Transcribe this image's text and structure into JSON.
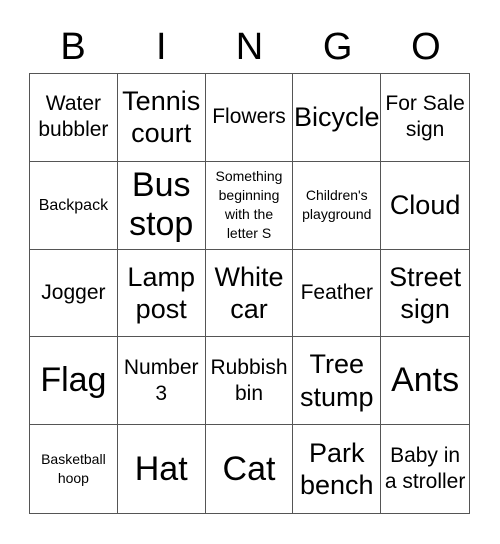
{
  "header": [
    "B",
    "I",
    "N",
    "G",
    "O"
  ],
  "cells": [
    {
      "text": "Water bubbler",
      "size": "m"
    },
    {
      "text": "Tennis court",
      "size": "l"
    },
    {
      "text": "Flowers",
      "size": "m"
    },
    {
      "text": "Bicycle",
      "size": "l"
    },
    {
      "text": "For Sale sign",
      "size": "m"
    },
    {
      "text": "Backpack",
      "size": "s"
    },
    {
      "text": "Bus stop",
      "size": "xl"
    },
    {
      "text": "Something beginning with the letter S",
      "size": "xs"
    },
    {
      "text": "Children's playground",
      "size": "xs"
    },
    {
      "text": "Cloud",
      "size": "l"
    },
    {
      "text": "Jogger",
      "size": "m"
    },
    {
      "text": "Lamp post",
      "size": "l"
    },
    {
      "text": "White car",
      "size": "l"
    },
    {
      "text": "Feather",
      "size": "m"
    },
    {
      "text": "Street sign",
      "size": "l"
    },
    {
      "text": "Flag",
      "size": "xl"
    },
    {
      "text": "Number 3",
      "size": "m"
    },
    {
      "text": "Rubbish bin",
      "size": "m"
    },
    {
      "text": "Tree stump",
      "size": "l"
    },
    {
      "text": "Ants",
      "size": "xl"
    },
    {
      "text": "Basketball hoop",
      "size": "xs"
    },
    {
      "text": "Hat",
      "size": "xl"
    },
    {
      "text": "Cat",
      "size": "xl"
    },
    {
      "text": "Park bench",
      "size": "l"
    },
    {
      "text": "Baby in a stroller",
      "size": "m"
    }
  ]
}
